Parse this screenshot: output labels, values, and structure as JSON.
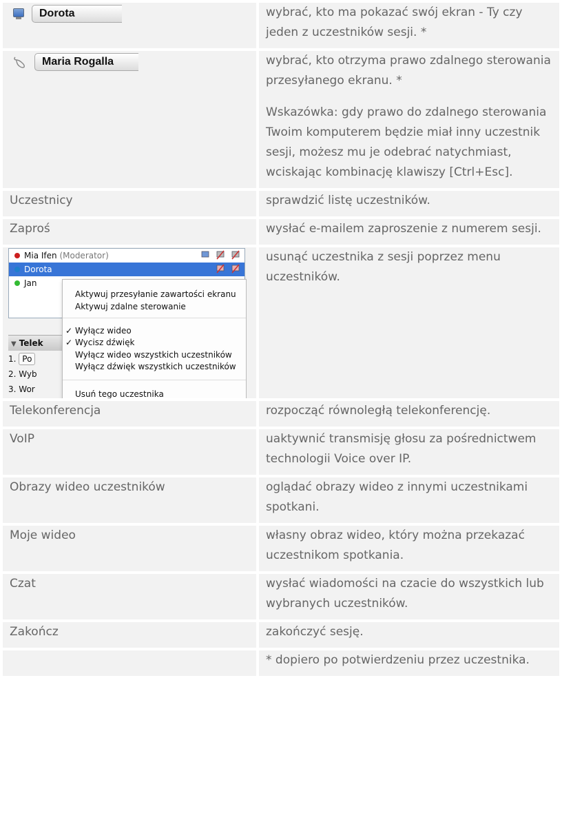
{
  "rows": [
    {
      "widget": "screen",
      "left_value": "Dorota",
      "icon": "screen-share-icon",
      "right": [
        "wybrać, kto ma pokazać swój ekran - Ty czy jeden z uczestników sesji. *"
      ]
    },
    {
      "widget": "remote",
      "left_value": "Maria Rogalla",
      "icon": "mouse-icon",
      "right": [
        "wybrać, kto otrzyma prawo zdalnego sterowania przesyłanego ekranu. *",
        "Wskazówka: gdy prawo do zdalnego sterowania Twoim komputerem będzie miał inny uczestnik sesji, możesz mu je odebrać natychmiast, wciskając kombinację klawiszy [Ctrl+Esc]."
      ]
    },
    {
      "label": "Uczestnicy",
      "right": [
        "sprawdzić listę uczestników."
      ]
    },
    {
      "label": "Zaproś",
      "right": [
        "wysłać e-mailem zaproszenie z numerem sesji."
      ]
    },
    {
      "widget": "participants",
      "right": [
        "usunąć uczestnika z sesji poprzez menu uczestników."
      ]
    },
    {
      "label": "Telekonferencja",
      "right": [
        "rozpocząć równoległą telekonferencję."
      ]
    },
    {
      "label": "VoIP",
      "right": [
        "uaktywnić transmisję głosu za pośrednictwem technologii Voice over IP."
      ]
    },
    {
      "label": "Obrazy wideo uczestników",
      "right": [
        "oglądać obrazy wideo z innymi uczestnikami spotkani."
      ]
    },
    {
      "label": "Moje wideo",
      "right": [
        "własny obraz wideo, który można przekazać uczestnikom spotkania."
      ]
    },
    {
      "label": "Czat",
      "right": [
        "wysłać wiadomości na czacie do wszystkich lub wybranych uczestników."
      ]
    },
    {
      "label": "Zakończ",
      "right": [
        "zakończyć sesję."
      ]
    },
    {
      "label": "",
      "right": [
        "* dopiero po potwierdzeniu przez uczestnika."
      ]
    }
  ],
  "participants_panel": {
    "participants": [
      {
        "name": "Mia Ifen",
        "role": "(Moderator)",
        "status_color": "#cc1f1f"
      },
      {
        "name": "Dorota",
        "role": "",
        "status_color": "#1f7fcc"
      },
      {
        "name": "Jan",
        "role": "",
        "status_color": "#33bb33"
      }
    ],
    "menu_items": [
      {
        "label": "Aktywuj przesyłanie zawartości ekranu",
        "checked": false
      },
      {
        "label": "Aktywuj zdalne sterowanie",
        "checked": false
      },
      {
        "label": "Wyłącz wideo",
        "checked": true
      },
      {
        "label": "Wycisz dźwięk",
        "checked": true
      },
      {
        "label": "Wyłącz wideo wszystkich uczestników",
        "checked": false
      },
      {
        "label": "Wyłącz dźwięk wszystkich uczestników",
        "checked": false
      },
      {
        "label": "Usuń tego uczestnika",
        "checked": false
      }
    ],
    "check_mark": "✓",
    "section_header": "Telek",
    "steps": [
      {
        "num": "1.",
        "text": "Po"
      },
      {
        "num": "2.",
        "text": "Wyb"
      },
      {
        "num": "3.",
        "text": "Wor"
      }
    ]
  }
}
